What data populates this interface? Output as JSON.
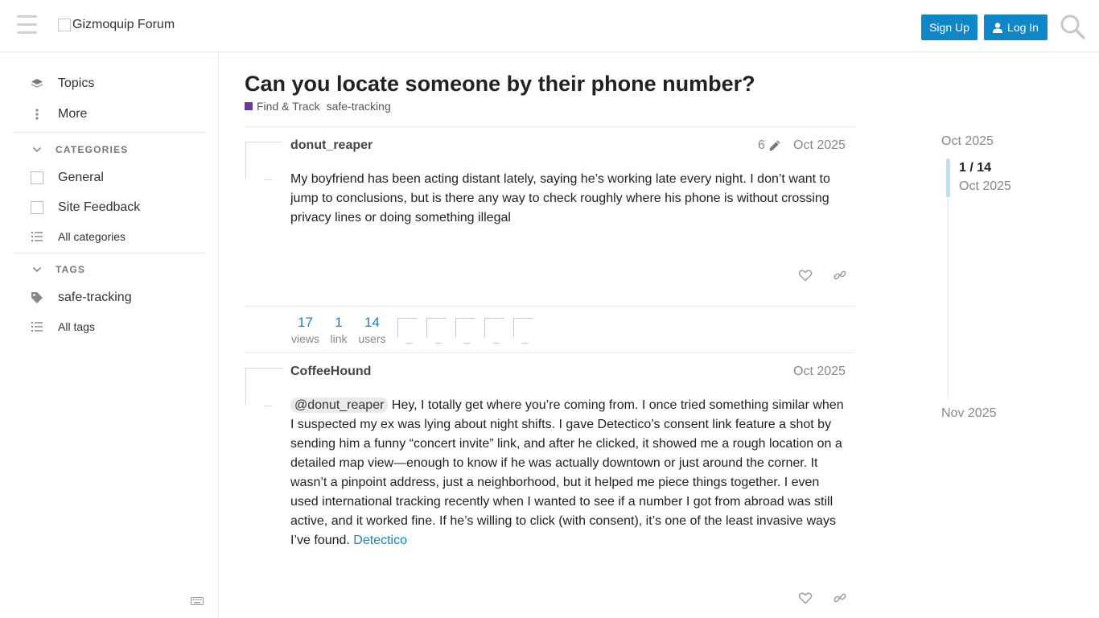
{
  "header": {
    "logo_alt": "Gizmoquip Forum",
    "signup_label": "Sign Up",
    "login_label": "Log In"
  },
  "sidebar": {
    "topics": "Topics",
    "more": "More",
    "categories_heading": "CATEGORIES",
    "categories": [
      "General",
      "Site Feedback"
    ],
    "all_categories": "All categories",
    "tags_heading": "TAGS",
    "tags": [
      "safe-tracking"
    ],
    "all_tags": "All tags"
  },
  "topic": {
    "title": "Can you locate someone by their phone number?",
    "category": "Find & Track",
    "category_color": "#6c3b96",
    "tag": "safe-tracking"
  },
  "posts": [
    {
      "username": "donut_reaper",
      "edits": "6",
      "date": "Oct 2025",
      "body": "My boyfriend has been acting distant lately, saying he’s working late every night. I don’t want to jump to conclusions, but is there any way to check roughly where his phone is without crossing privacy lines or doing something illegal"
    },
    {
      "username": "CoffeeHound",
      "date": "Oct 2025",
      "mention": "@donut_reaper",
      "body": " Hey, I totally get where you’re coming from. I once tried something similar when I suspected my ex was lying about night shifts. I gave Detectico’s consent link feature a shot by sending him a funny “concert invite” link, and after he clicked, it showed me a rough location on a detailed map view—enough to know if he was actually downtown or just around the corner. It wasn’t a pinpoint address, just a neighborhood, but it helped me piece things together. I even used international tracking recently when I wanted to see if a number I got from abroad was still active, and it worked fine. If he’s willing to click (with consent), it’s one of the least invasive ways I’ve found. ",
      "link": "Detectico"
    }
  ],
  "stats": {
    "views_n": "17",
    "views_l": "views",
    "link_n": "1",
    "link_l": "link",
    "users_n": "14",
    "users_l": "users"
  },
  "timeline": {
    "start": "Oct 2025",
    "position": "1 / 14",
    "position_date": "Oct 2025",
    "end": "Nov 2025"
  },
  "colors": {
    "accent": "#0f86c7"
  }
}
